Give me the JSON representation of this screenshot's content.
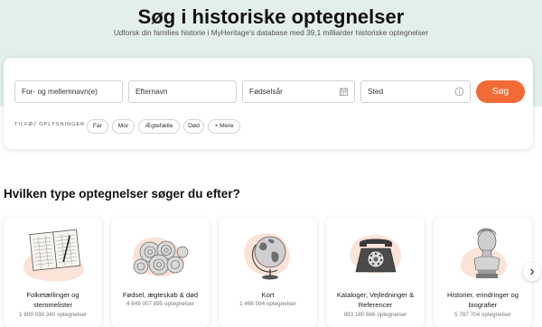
{
  "hero": {
    "title": "Søg i historiske optegnelser",
    "subtitle": "Udforsk din families historie i MyHeritage's database med 39,1 milliarder historiske optegnelser"
  },
  "search": {
    "first_name_placeholder": "For- og mellemnavn(e)",
    "last_name_placeholder": "Efternavn",
    "birth_year_placeholder": "Fødselsår",
    "place_placeholder": "Sted",
    "button_label": "Søg",
    "add_info_label": "TILFØJ OPLYSNINGER",
    "chips": [
      "Far",
      "Mor",
      "Ægtefælle",
      "Død",
      "+ Mere"
    ],
    "accent_color": "#f26b36"
  },
  "categories": {
    "heading": "Hvilken type optegnelser søger du efter?",
    "items": [
      {
        "name": "Folketællinger og stemmelister",
        "count": "1 809 038 340 optegnelser",
        "icon": "census-book-icon"
      },
      {
        "name": "Fødsel, ægteskab & død",
        "count": "4 649 007 895 optegnelser",
        "icon": "roses-icon"
      },
      {
        "name": "Kort",
        "count": "1 466 594 optegnelser",
        "icon": "globe-icon"
      },
      {
        "name": "Kataloger, Vejledninger & Referencer",
        "count": "993 180 666 optegnelser",
        "icon": "telephone-icon"
      },
      {
        "name": "Historier, erindringer og biografier",
        "count": "5 787 704 optegnelser",
        "icon": "bust-statue-icon"
      }
    ],
    "next_icon": "chevron-right-icon"
  }
}
